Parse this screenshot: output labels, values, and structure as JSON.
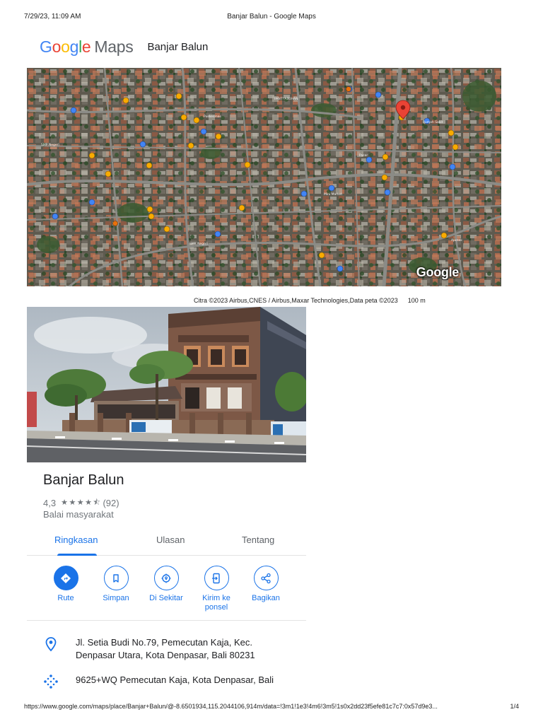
{
  "print": {
    "date": "7/29/23, 11:09 AM",
    "doc_title": "Banjar Balun - Google Maps",
    "url": "https://www.google.com/maps/place/Banjar+Balun/@-8.6501934,115.2044106,914m/data=!3m1!1e3!4m6!3m5!1s0x2dd23f5efe81c7c7:0x57d9e3...",
    "page": "1/4"
  },
  "header": {
    "logo_letters": [
      "G",
      "o",
      "o",
      "g",
      "l",
      "e"
    ],
    "logo_maps": "Maps",
    "place_title": "Banjar Balun"
  },
  "map": {
    "watermark": "Google",
    "attribution": "Citra ©2023 Airbus,CNES / Airbus,Maxar Technologies,Data peta ©2023",
    "scale": "100 m",
    "pin_color": "#ea4335"
  },
  "place": {
    "name": "Banjar Balun",
    "rating": "4,3",
    "stars": "★★★★⯪",
    "review_count": "(92)",
    "category": "Balai masyarakat"
  },
  "tabs": [
    {
      "label": "Ringkasan",
      "active": true
    },
    {
      "label": "Ulasan",
      "active": false
    },
    {
      "label": "Tentang",
      "active": false
    }
  ],
  "actions": [
    {
      "label": "Rute",
      "icon": "directions-icon"
    },
    {
      "label": "Simpan",
      "icon": "bookmark-icon"
    },
    {
      "label": "Di Sekitar",
      "icon": "nearby-icon"
    },
    {
      "label": "Kirim ke ponsel",
      "icon": "send-to-phone-icon"
    },
    {
      "label": "Bagikan",
      "icon": "share-icon"
    }
  ],
  "info": {
    "address": "Jl. Setia Budi No.79, Pemecutan Kaja, Kec. Denpasar Utara, Kota Denpasar, Bali 80231",
    "plus_code": "9625+WQ Pemecutan Kaja, Kota Denpasar, Bali"
  },
  "colors": {
    "accent": "#1a73e8",
    "text": "#202124",
    "secondary_text": "#70757a"
  }
}
